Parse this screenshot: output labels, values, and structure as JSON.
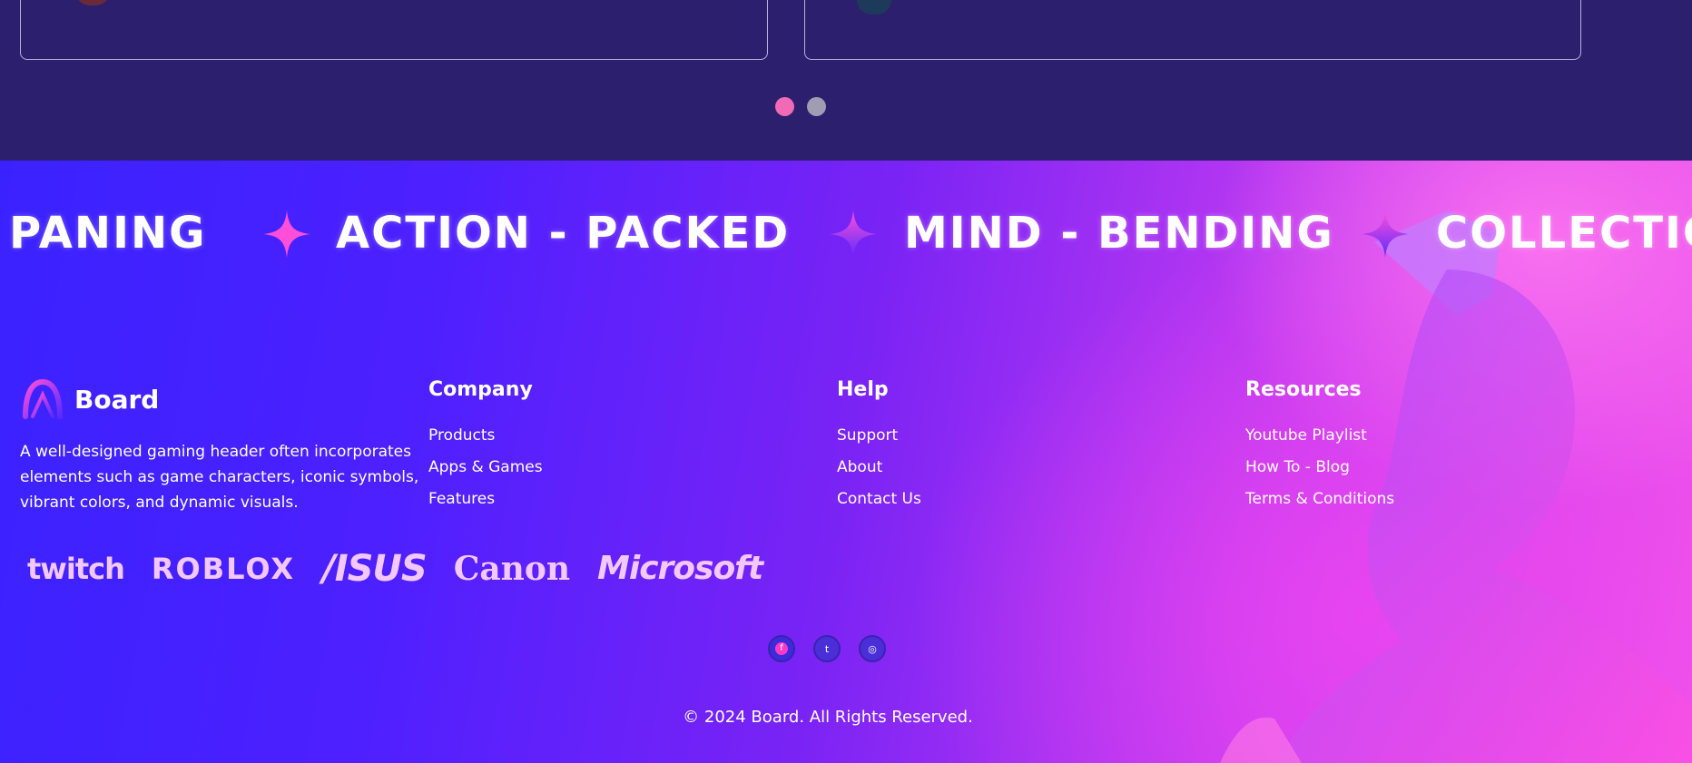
{
  "marquee": {
    "items": [
      "PANING",
      "ACTION - PACKED",
      "MIND - BENDING",
      "COLLECTIC"
    ]
  },
  "brand": {
    "name": "Board",
    "description": "A well-designed gaming header often incorporates elements such as game characters, iconic symbols, vibrant colors, and dynamic visuals."
  },
  "columns": {
    "company": {
      "title": "Company",
      "links": [
        "Products",
        "Apps & Games",
        "Features"
      ]
    },
    "help": {
      "title": "Help",
      "links": [
        "Support",
        "About",
        "Contact Us"
      ]
    },
    "resources": {
      "title": "Resources",
      "links": [
        "Youtube Playlist",
        "How To - Blog",
        "Terms & Conditions"
      ]
    }
  },
  "partners": [
    "twitch",
    "ROBLOX",
    "/ISUS",
    "Canon",
    "Microsoft"
  ],
  "socials": {
    "facebook": "f",
    "twitter": "t",
    "instagram": "◎"
  },
  "copyright": "© 2024 Board. All Rights Reserved.",
  "colors": {
    "top_bg": "#2c1f6e",
    "dot_active": "#f06ab5",
    "dot_inactive": "#a09db3",
    "gradient_start": "#3a22ff",
    "gradient_end": "#f052ea",
    "partner_logo": "#f2c8ff"
  },
  "slider": {
    "active_index": 0,
    "count": 2
  }
}
